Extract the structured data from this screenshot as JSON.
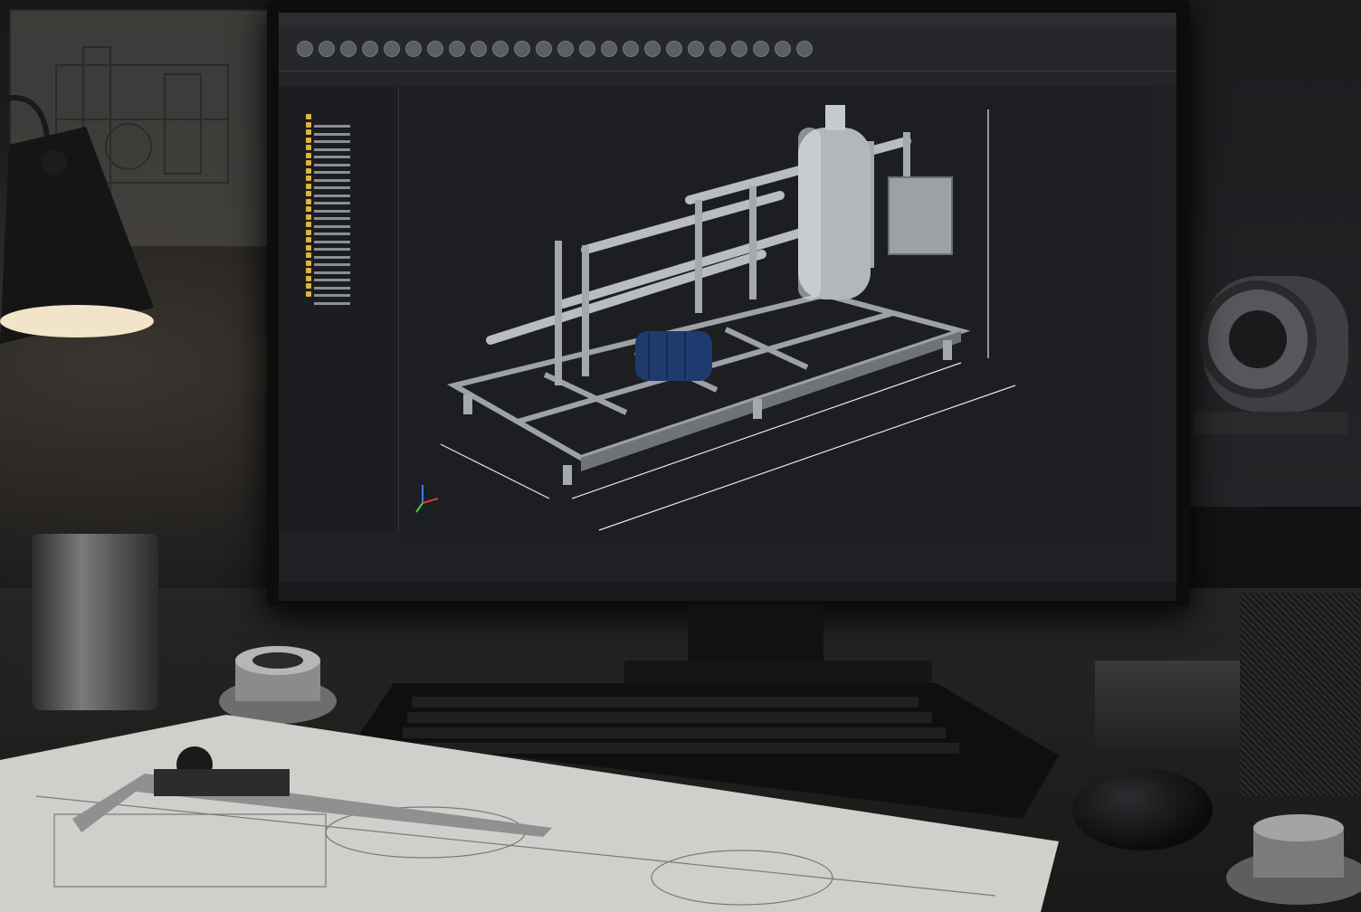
{
  "scene": {
    "description_label": "",
    "colors": {
      "background": "#141415",
      "screen_bg": "#1e2023",
      "viewport_bg": "#1c1e21",
      "tree_icon": "#e0b43a",
      "motor_blue": "#1f3a6e",
      "steel": "#b9bcc0"
    }
  },
  "cad": {
    "ribbon_icons": [
      "tool-icon",
      "tool-icon",
      "tool-icon",
      "tool-icon",
      "tool-icon",
      "tool-icon",
      "tool-icon",
      "tool-icon",
      "tool-icon",
      "tool-icon",
      "tool-icon",
      "tool-icon",
      "tool-icon",
      "tool-icon",
      "tool-icon",
      "tool-icon",
      "tool-icon",
      "tool-icon",
      "tool-icon",
      "tool-icon",
      "tool-icon",
      "tool-icon",
      "tool-icon",
      "tool-icon"
    ],
    "view_icons": [
      "view-icon",
      "view-icon",
      "view-icon",
      "view-icon",
      "view-icon",
      "view-icon",
      "view-icon",
      "view-icon",
      "view-icon",
      "view-icon"
    ],
    "tree_row_count": 24
  }
}
